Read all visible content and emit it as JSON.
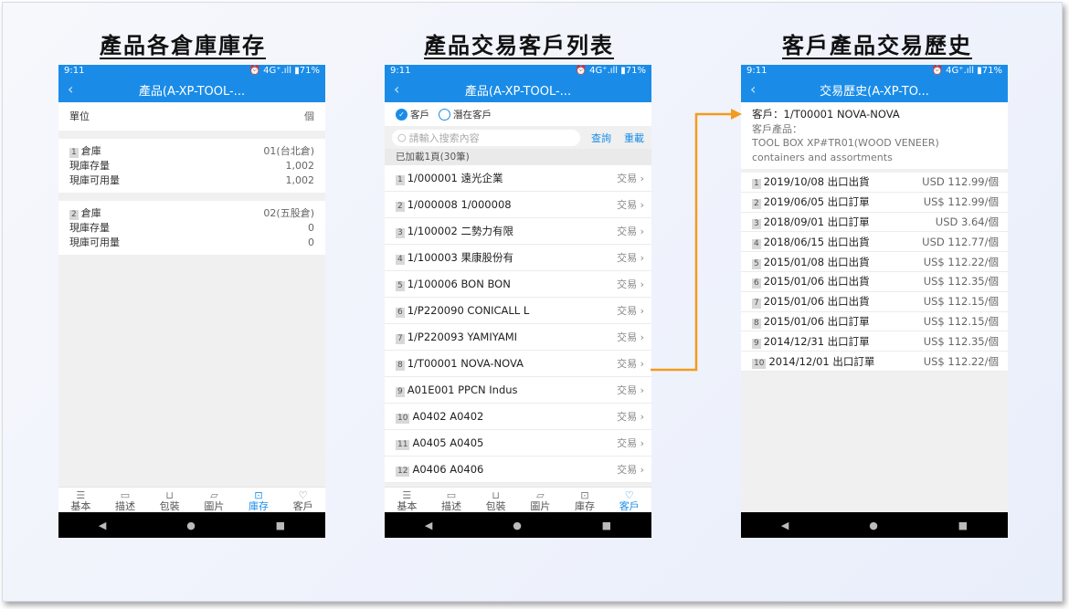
{
  "captions": {
    "left": "產品各倉庫庫存",
    "middle": "產品交易客戶列表",
    "right": "客戶產品交易歷史"
  },
  "status": {
    "time": "9:11",
    "indicators": "⏰ 4G⁺.ıll ▮71%"
  },
  "left": {
    "title": "產品(A-XP-TOOL-...",
    "unit_label": "單位",
    "unit_value": "個",
    "warehouses": [
      {
        "idx": "1",
        "label": "倉庫",
        "value": "01(台北倉)",
        "stock_label": "現庫存量",
        "stock": "1,002",
        "avail_label": "現庫可用量",
        "avail": "1,002"
      },
      {
        "idx": "2",
        "label": "倉庫",
        "value": "02(五股倉)",
        "stock_label": "現庫存量",
        "stock": "0",
        "avail_label": "現庫可用量",
        "avail": "0"
      }
    ]
  },
  "middle": {
    "title": "產品(A-XP-TOOL-...",
    "radio_customer": "客戶",
    "radio_prospect": "潛在客戶",
    "search_placeholder": "請輸入搜索內容",
    "query_button": "查詢",
    "reset_button": "重載",
    "loaded_text": "已加載1頁(30筆)",
    "action_label": "交易",
    "customers": [
      {
        "idx": "1",
        "name": "1/000001 遠光企業"
      },
      {
        "idx": "2",
        "name": "1/000008 1/000008"
      },
      {
        "idx": "3",
        "name": "1/100002 二勢力有限"
      },
      {
        "idx": "4",
        "name": "1/100003 果康股份有"
      },
      {
        "idx": "5",
        "name": "1/100006 BON BON"
      },
      {
        "idx": "6",
        "name": "1/P220090 CONICALL L"
      },
      {
        "idx": "7",
        "name": "1/P220093 YAMIYAMI"
      },
      {
        "idx": "8",
        "name": "1/T00001 NOVA-NOVA"
      },
      {
        "idx": "9",
        "name": "A01E001 PPCN Indus"
      },
      {
        "idx": "10",
        "name": "A0402 A0402"
      },
      {
        "idx": "11",
        "name": "A0405 A0405"
      },
      {
        "idx": "12",
        "name": "A0406 A0406"
      }
    ]
  },
  "right": {
    "title": "交易歷史(A-XP-TO...",
    "customer_line": "客戶：1/T00001 NOVA-NOVA",
    "product_label": "客戶產品：",
    "product_line1": "TOOL BOX XP#TR01(WOOD VENEER)",
    "product_line2": "containers and assortments",
    "history": [
      {
        "idx": "1",
        "text": "2019/10/08 出口出貨",
        "amount": "USD 112.99/個"
      },
      {
        "idx": "2",
        "text": "2019/06/05 出口訂單",
        "amount": "US$ 112.99/個"
      },
      {
        "idx": "3",
        "text": "2018/09/01 出口訂單",
        "amount": "USD 3.64/個"
      },
      {
        "idx": "4",
        "text": "2018/06/15 出口出貨",
        "amount": "USD 112.77/個"
      },
      {
        "idx": "5",
        "text": "2015/01/08 出口出貨",
        "amount": "US$ 112.22/個"
      },
      {
        "idx": "6",
        "text": "2015/01/06 出口出貨",
        "amount": "US$ 112.35/個"
      },
      {
        "idx": "7",
        "text": "2015/01/06 出口出貨",
        "amount": "US$ 112.15/個"
      },
      {
        "idx": "8",
        "text": "2015/01/06 出口訂單",
        "amount": "US$ 112.15/個"
      },
      {
        "idx": "9",
        "text": "2014/12/31 出口訂單",
        "amount": "US$ 112.35/個"
      },
      {
        "idx": "10",
        "text": "2014/12/01 出口訂單",
        "amount": "US$ 112.22/個"
      }
    ]
  },
  "tabs": [
    {
      "label": "基本",
      "icon": "list-icon"
    },
    {
      "label": "描述",
      "icon": "chat-icon"
    },
    {
      "label": "包裝",
      "icon": "cart-icon"
    },
    {
      "label": "圖片",
      "icon": "image-icon"
    },
    {
      "label": "庫存",
      "icon": "box-icon"
    },
    {
      "label": "客戶",
      "icon": "heart-icon"
    }
  ],
  "colors": {
    "accent": "#1a8ce8",
    "arrow": "#f39b1e"
  }
}
